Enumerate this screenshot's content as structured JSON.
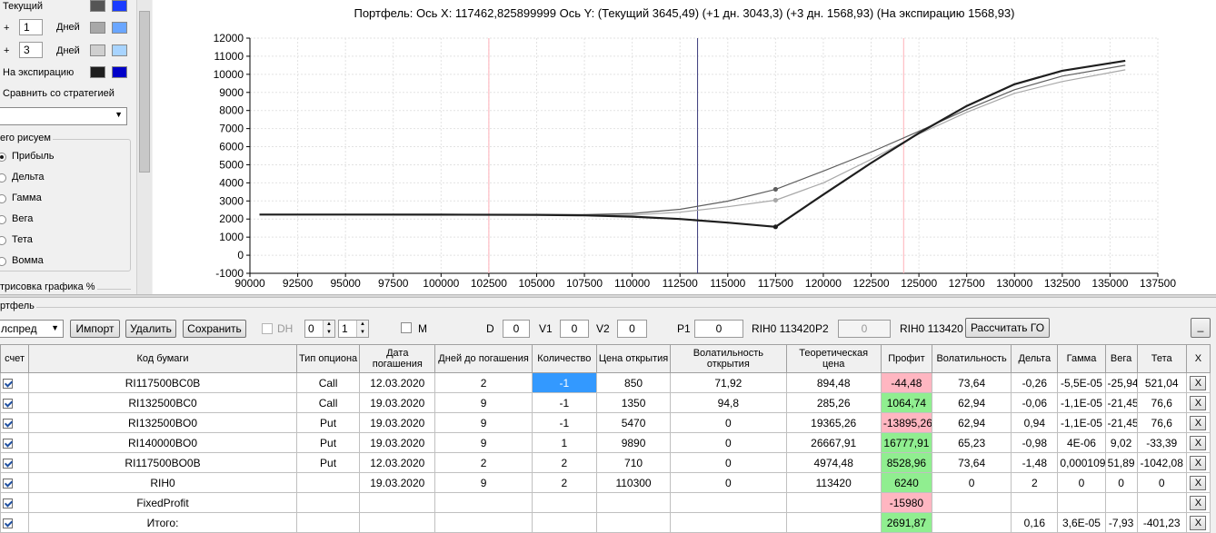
{
  "left_panel": {
    "rows": [
      {
        "label": "Текущий",
        "prefix": "",
        "days": "",
        "days_label": "",
        "color1": "#555555",
        "color2": "#1a3cff"
      },
      {
        "label": "",
        "prefix": "+",
        "days": "1",
        "days_label": "Дней",
        "color1": "#a8a8a8",
        "color2": "#6aa6ff"
      },
      {
        "label": "",
        "prefix": "+",
        "days": "3",
        "days_label": "Дней",
        "color1": "#cfcfcf",
        "color2": "#a8d4ff"
      },
      {
        "label": "На экспирацию",
        "prefix": "",
        "days": "",
        "days_label": "",
        "color1": "#1e1e1e",
        "color2": "#0000c8"
      }
    ],
    "compare_label": "Сравнить со стратегией",
    "compare_value": "",
    "draw_group_title": "его рисуем",
    "draw_options": [
      "Прибыль",
      "Дельта",
      "Гамма",
      "Вега",
      "Тета",
      "Вомма"
    ],
    "draw_selected": "Прибыль",
    "render_group_title": "трисовка графика %"
  },
  "chart": {
    "title": "Портфель: Ось X: 117462,825899999 Ось Y:  (Текущий 3645,49)  (+1 дн. 3043,3)  (+3 дн. 1568,93)  (На экспирацию 1568,93)"
  },
  "chart_data": {
    "type": "line",
    "xlim": [
      90000,
      137500
    ],
    "ylim": [
      -1000,
      12000
    ],
    "x_ticks": [
      "90000",
      "92500",
      "95000",
      "97500",
      "100000",
      "102500",
      "105000",
      "107500",
      "110000",
      "112500",
      "115000",
      "117500",
      "120000",
      "122500",
      "125000",
      "127500",
      "130000",
      "132500",
      "135000",
      "137500"
    ],
    "y_ticks": [
      "-1000",
      "0",
      "1000",
      "2000",
      "3000",
      "4000",
      "5000",
      "6000",
      "7000",
      "8000",
      "9000",
      "10000",
      "11000",
      "12000"
    ],
    "grid": true,
    "vertical_lines": [
      {
        "x": 102500,
        "color": "#ffb0b8"
      },
      {
        "x": 113420,
        "color": "#3a3a7a"
      },
      {
        "x": 124200,
        "color": "#ffb0b8"
      }
    ],
    "series": [
      {
        "color": "#1e1e1e",
        "width": 2.2,
        "x": [
          90500,
          95000,
          100000,
          105000,
          107500,
          110000,
          112500,
          115000,
          117500,
          120000,
          122500,
          125000,
          127500,
          130000,
          132500,
          135800
        ],
        "y": [
          2250,
          2250,
          2240,
          2230,
          2200,
          2130,
          2000,
          1800,
          1570,
          3350,
          5100,
          6750,
          8250,
          9450,
          10200,
          10750
        ]
      },
      {
        "color": "#5e5e5e",
        "width": 1.2,
        "x": [
          90500,
          100000,
          105000,
          107500,
          110000,
          112500,
          115000,
          117500,
          120000,
          122500,
          125000,
          127500,
          130000,
          132500,
          135800
        ],
        "y": [
          2250,
          2240,
          2240,
          2240,
          2310,
          2540,
          2990,
          3640,
          4650,
          5700,
          6850,
          8050,
          9150,
          9900,
          10500
        ]
      },
      {
        "color": "#a8a8a8",
        "width": 1.2,
        "x": [
          90500,
          100000,
          105000,
          107500,
          110000,
          112500,
          115000,
          117500,
          120000,
          122500,
          125000,
          127500,
          130000,
          132500,
          135800
        ],
        "y": [
          2250,
          2240,
          2220,
          2220,
          2220,
          2380,
          2680,
          3040,
          4000,
          5300,
          6700,
          7900,
          8950,
          9600,
          10250
        ]
      }
    ],
    "markers": [
      {
        "x": 117500,
        "y": 3645,
        "color": "#5e5e5e"
      },
      {
        "x": 117500,
        "y": 3043,
        "color": "#a8a8a8"
      },
      {
        "x": 117500,
        "y": 1569,
        "color": "#1e1e1e"
      }
    ]
  },
  "portfolio": {
    "group_label": "ртфель",
    "strategy_value": "лспред",
    "import_label": "Импорт",
    "delete_label": "Удалить",
    "save_label": "Сохранить",
    "dh_label": "DH",
    "spin1": "0",
    "spin2": "1",
    "m_label": "M",
    "d_label": "D",
    "d_value": "0",
    "v1_label": "V1",
    "v1_value": "0",
    "v2_label": "V2",
    "v2_value": "0",
    "p1_label": "P1",
    "p1_value": "0",
    "p1_ticker": "RIH0 113420",
    "p2_label": "P2",
    "p2_value": "0",
    "p2_ticker": "RIH0 113420",
    "calc_label": "Рассчитать ГО",
    "minimize_label": "_"
  },
  "table": {
    "headers": [
      "счет",
      "Код бумаги",
      "Тип опциона",
      "Дата погашения",
      "Дней до погашения",
      "Количество",
      "Цена открытия",
      "Волатильность открытия",
      "Теоретическая цена",
      "Профит",
      "Волатильность",
      "Дельта",
      "Гамма",
      "Вега",
      "Тета",
      "X"
    ],
    "rows": [
      {
        "code": "RI117500BC0B",
        "type": "Call",
        "date": "12.03.2020",
        "days": "2",
        "qty": "-1",
        "price": "850",
        "vol_open": "71,92",
        "theo": "894,48",
        "profit": "-44,48",
        "vol": "73,64",
        "delta": "-0,26",
        "gamma": "-5,5E-05",
        "vega": "-25,94",
        "theta": "521,04",
        "profit_class": "neg",
        "check": true
      },
      {
        "code": "RI132500BC0",
        "type": "Call",
        "date": "19.03.2020",
        "days": "9",
        "qty": "-1",
        "price": "1350",
        "vol_open": "94,8",
        "theo": "285,26",
        "profit": "1064,74",
        "vol": "62,94",
        "delta": "-0,06",
        "gamma": "-1,1E-05",
        "vega": "-21,45",
        "theta": "76,6",
        "profit_class": "pos",
        "check": true
      },
      {
        "code": "RI132500BO0",
        "type": "Put",
        "date": "19.03.2020",
        "days": "9",
        "qty": "-1",
        "price": "5470",
        "vol_open": "0",
        "theo": "19365,26",
        "profit": "-13895,26",
        "vol": "62,94",
        "delta": "0,94",
        "gamma": "-1,1E-05",
        "vega": "-21,45",
        "theta": "76,6",
        "profit_class": "neg",
        "check": true
      },
      {
        "code": "RI140000BO0",
        "type": "Put",
        "date": "19.03.2020",
        "days": "9",
        "qty": "1",
        "price": "9890",
        "vol_open": "0",
        "theo": "26667,91",
        "profit": "16777,91",
        "vol": "65,23",
        "delta": "-0,98",
        "gamma": "4E-06",
        "vega": "9,02",
        "theta": "-33,39",
        "profit_class": "pos",
        "check": true
      },
      {
        "code": "RI117500BO0B",
        "type": "Put",
        "date": "12.03.2020",
        "days": "2",
        "qty": "2",
        "price": "710",
        "vol_open": "0",
        "theo": "4974,48",
        "profit": "8528,96",
        "vol": "73,64",
        "delta": "-1,48",
        "gamma": "0,000109",
        "vega": "51,89",
        "theta": "-1042,08",
        "profit_class": "pos",
        "check": true
      },
      {
        "code": "RIH0",
        "type": "",
        "date": "19.03.2020",
        "days": "9",
        "qty": "2",
        "price": "110300",
        "vol_open": "0",
        "theo": "113420",
        "profit": "6240",
        "vol": "0",
        "delta": "2",
        "gamma": "0",
        "vega": "0",
        "theta": "0",
        "profit_class": "pos",
        "check": true
      },
      {
        "code": "FixedProfit",
        "type": "",
        "date": "",
        "days": "",
        "qty": "",
        "price": "",
        "vol_open": "",
        "theo": "",
        "profit": "-15980",
        "vol": "",
        "delta": "",
        "gamma": "",
        "vega": "",
        "theta": "",
        "profit_class": "neg",
        "check": true
      },
      {
        "code": "Итого:",
        "type": "",
        "date": "",
        "days": "",
        "qty": "",
        "price": "",
        "vol_open": "",
        "theo": "",
        "profit": "2691,87",
        "vol": "",
        "delta": "0,16",
        "gamma": "3,6E-05",
        "vega": "-7,93",
        "theta": "-401,23",
        "profit_class": "pos",
        "check": true
      }
    ],
    "row_button_label": "X"
  }
}
